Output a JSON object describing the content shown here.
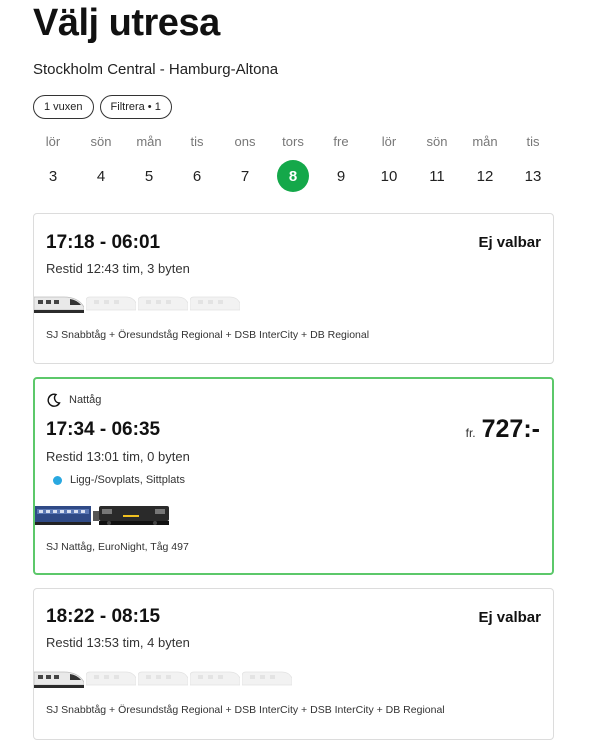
{
  "header": {
    "title": "Välj utresa",
    "route": "Stockholm Central - Hamburg-Altona"
  },
  "filters": {
    "passengers": "1 vuxen",
    "filter": "Filtrera • 1"
  },
  "dates": [
    {
      "day": "lör",
      "num": "3"
    },
    {
      "day": "sön",
      "num": "4"
    },
    {
      "day": "mån",
      "num": "5"
    },
    {
      "day": "tis",
      "num": "6"
    },
    {
      "day": "ons",
      "num": "7"
    },
    {
      "day": "tors",
      "num": "8",
      "selected": true
    },
    {
      "day": "fre",
      "num": "9"
    },
    {
      "day": "lör",
      "num": "10"
    },
    {
      "day": "sön",
      "num": "11"
    },
    {
      "day": "mån",
      "num": "12"
    },
    {
      "day": "tis",
      "num": "13"
    }
  ],
  "trips": [
    {
      "time": "17:18 - 06:01",
      "status": "Ej valbar",
      "duration": "Restid 12:43 tim, 3 byten",
      "trains": "SJ Snabbtåg + Öresundståg Regional + DSB InterCity + DB Regional"
    },
    {
      "badge": "Nattåg",
      "time": "17:34 - 06:35",
      "price_prefix": "fr.",
      "price": "727:-",
      "duration": "Restid 13:01 tim, 0 byten",
      "seat_types": "Ligg-/Sovplats, Sittplats",
      "trains": "SJ Nattåg, EuroNight, Tåg 497"
    },
    {
      "time": "18:22 - 08:15",
      "status": "Ej valbar",
      "duration": "Restid 13:53 tim, 4 byten",
      "trains": "SJ Snabbtåg + Öresundståg Regional + DSB InterCity + DSB InterCity + DB Regional"
    }
  ],
  "colors": {
    "accent_green": "#14a84a",
    "active_border": "#5cc86a",
    "seat_dot": "#29a8e0"
  }
}
